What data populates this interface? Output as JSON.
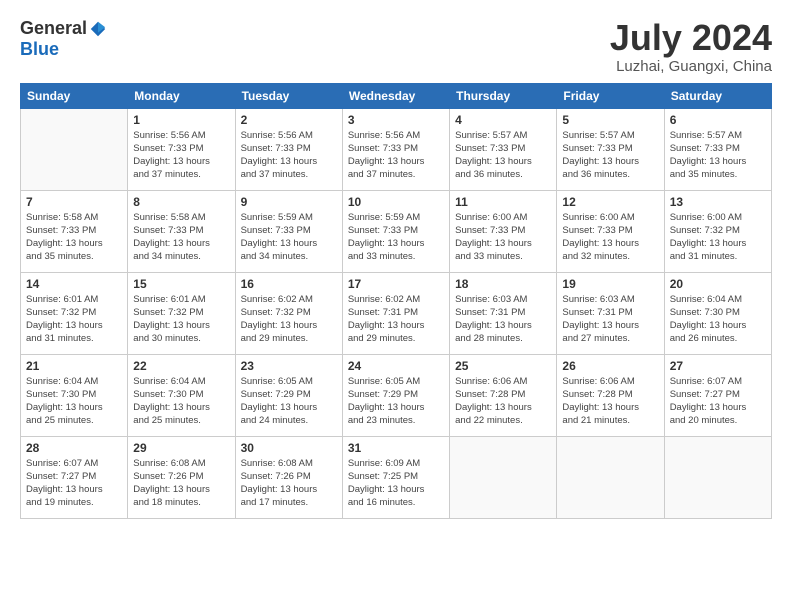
{
  "logo": {
    "general": "General",
    "blue": "Blue"
  },
  "title": "July 2024",
  "location": "Luzhai, Guangxi, China",
  "days_of_week": [
    "Sunday",
    "Monday",
    "Tuesday",
    "Wednesday",
    "Thursday",
    "Friday",
    "Saturday"
  ],
  "weeks": [
    [
      {
        "day": "",
        "info": ""
      },
      {
        "day": "1",
        "info": "Sunrise: 5:56 AM\nSunset: 7:33 PM\nDaylight: 13 hours\nand 37 minutes."
      },
      {
        "day": "2",
        "info": "Sunrise: 5:56 AM\nSunset: 7:33 PM\nDaylight: 13 hours\nand 37 minutes."
      },
      {
        "day": "3",
        "info": "Sunrise: 5:56 AM\nSunset: 7:33 PM\nDaylight: 13 hours\nand 37 minutes."
      },
      {
        "day": "4",
        "info": "Sunrise: 5:57 AM\nSunset: 7:33 PM\nDaylight: 13 hours\nand 36 minutes."
      },
      {
        "day": "5",
        "info": "Sunrise: 5:57 AM\nSunset: 7:33 PM\nDaylight: 13 hours\nand 36 minutes."
      },
      {
        "day": "6",
        "info": "Sunrise: 5:57 AM\nSunset: 7:33 PM\nDaylight: 13 hours\nand 35 minutes."
      }
    ],
    [
      {
        "day": "7",
        "info": "Sunrise: 5:58 AM\nSunset: 7:33 PM\nDaylight: 13 hours\nand 35 minutes."
      },
      {
        "day": "8",
        "info": "Sunrise: 5:58 AM\nSunset: 7:33 PM\nDaylight: 13 hours\nand 34 minutes."
      },
      {
        "day": "9",
        "info": "Sunrise: 5:59 AM\nSunset: 7:33 PM\nDaylight: 13 hours\nand 34 minutes."
      },
      {
        "day": "10",
        "info": "Sunrise: 5:59 AM\nSunset: 7:33 PM\nDaylight: 13 hours\nand 33 minutes."
      },
      {
        "day": "11",
        "info": "Sunrise: 6:00 AM\nSunset: 7:33 PM\nDaylight: 13 hours\nand 33 minutes."
      },
      {
        "day": "12",
        "info": "Sunrise: 6:00 AM\nSunset: 7:33 PM\nDaylight: 13 hours\nand 32 minutes."
      },
      {
        "day": "13",
        "info": "Sunrise: 6:00 AM\nSunset: 7:32 PM\nDaylight: 13 hours\nand 31 minutes."
      }
    ],
    [
      {
        "day": "14",
        "info": "Sunrise: 6:01 AM\nSunset: 7:32 PM\nDaylight: 13 hours\nand 31 minutes."
      },
      {
        "day": "15",
        "info": "Sunrise: 6:01 AM\nSunset: 7:32 PM\nDaylight: 13 hours\nand 30 minutes."
      },
      {
        "day": "16",
        "info": "Sunrise: 6:02 AM\nSunset: 7:32 PM\nDaylight: 13 hours\nand 29 minutes."
      },
      {
        "day": "17",
        "info": "Sunrise: 6:02 AM\nSunset: 7:31 PM\nDaylight: 13 hours\nand 29 minutes."
      },
      {
        "day": "18",
        "info": "Sunrise: 6:03 AM\nSunset: 7:31 PM\nDaylight: 13 hours\nand 28 minutes."
      },
      {
        "day": "19",
        "info": "Sunrise: 6:03 AM\nSunset: 7:31 PM\nDaylight: 13 hours\nand 27 minutes."
      },
      {
        "day": "20",
        "info": "Sunrise: 6:04 AM\nSunset: 7:30 PM\nDaylight: 13 hours\nand 26 minutes."
      }
    ],
    [
      {
        "day": "21",
        "info": "Sunrise: 6:04 AM\nSunset: 7:30 PM\nDaylight: 13 hours\nand 25 minutes."
      },
      {
        "day": "22",
        "info": "Sunrise: 6:04 AM\nSunset: 7:30 PM\nDaylight: 13 hours\nand 25 minutes."
      },
      {
        "day": "23",
        "info": "Sunrise: 6:05 AM\nSunset: 7:29 PM\nDaylight: 13 hours\nand 24 minutes."
      },
      {
        "day": "24",
        "info": "Sunrise: 6:05 AM\nSunset: 7:29 PM\nDaylight: 13 hours\nand 23 minutes."
      },
      {
        "day": "25",
        "info": "Sunrise: 6:06 AM\nSunset: 7:28 PM\nDaylight: 13 hours\nand 22 minutes."
      },
      {
        "day": "26",
        "info": "Sunrise: 6:06 AM\nSunset: 7:28 PM\nDaylight: 13 hours\nand 21 minutes."
      },
      {
        "day": "27",
        "info": "Sunrise: 6:07 AM\nSunset: 7:27 PM\nDaylight: 13 hours\nand 20 minutes."
      }
    ],
    [
      {
        "day": "28",
        "info": "Sunrise: 6:07 AM\nSunset: 7:27 PM\nDaylight: 13 hours\nand 19 minutes."
      },
      {
        "day": "29",
        "info": "Sunrise: 6:08 AM\nSunset: 7:26 PM\nDaylight: 13 hours\nand 18 minutes."
      },
      {
        "day": "30",
        "info": "Sunrise: 6:08 AM\nSunset: 7:26 PM\nDaylight: 13 hours\nand 17 minutes."
      },
      {
        "day": "31",
        "info": "Sunrise: 6:09 AM\nSunset: 7:25 PM\nDaylight: 13 hours\nand 16 minutes."
      },
      {
        "day": "",
        "info": ""
      },
      {
        "day": "",
        "info": ""
      },
      {
        "day": "",
        "info": ""
      }
    ]
  ]
}
